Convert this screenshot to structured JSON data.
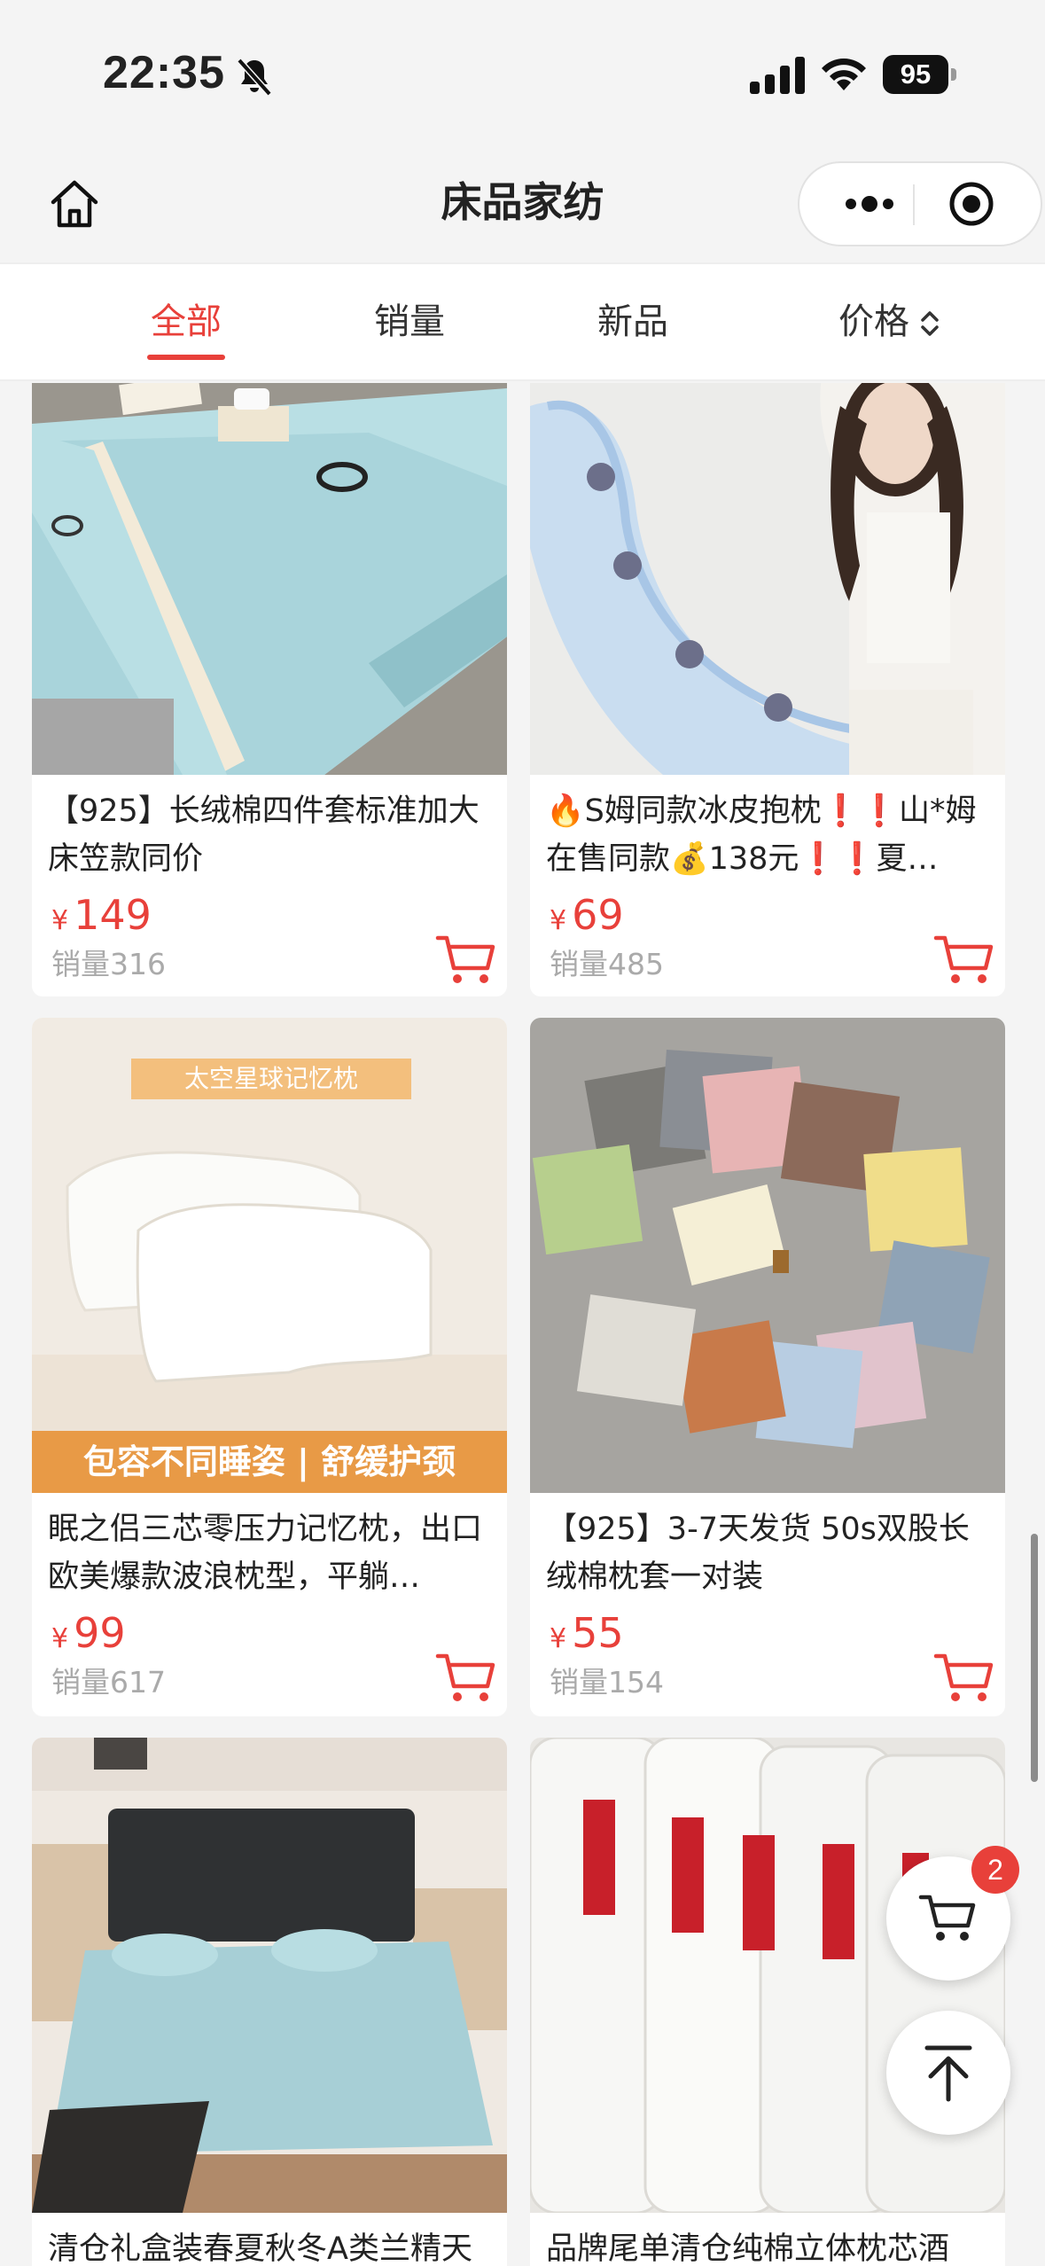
{
  "status_bar": {
    "time": "22:35",
    "battery": "95"
  },
  "nav": {
    "title": "床品家纺"
  },
  "tabs": [
    {
      "label": "全部",
      "active": true
    },
    {
      "label": "销量",
      "active": false
    },
    {
      "label": "新品",
      "active": false
    },
    {
      "label": "价格",
      "active": false
    }
  ],
  "products": [
    {
      "name": "【925】长绒棉四件套标准加大床笠款同价",
      "currency": "¥",
      "price": "149",
      "sold": "销量316"
    },
    {
      "name": "🔥S姆同款冰皮抱枕❗️❗️山*姆在售同款💰138元❗️❗️夏…",
      "currency": "¥",
      "price": "69",
      "sold": "销量485"
    },
    {
      "name": "眠之侣三芯零压力记忆枕，出口欧美爆款波浪枕型，平躺…",
      "currency": "¥",
      "price": "99",
      "sold": "销量617",
      "image_banner_top": "太空星球记忆枕",
      "image_banner_bottom": "包容不同睡姿 | 舒缓护颈"
    },
    {
      "name": "【925】3-7天发货 50s双股长绒棉枕套一对装",
      "currency": "¥",
      "price": "55",
      "sold": "销量154"
    },
    {
      "name": "清仓礼盒装春夏秋冬A类兰精天",
      "currency": "",
      "price": "",
      "sold": ""
    },
    {
      "name": "品牌尾单清仓纯棉立体枕芯酒",
      "currency": "",
      "price": "",
      "sold": ""
    }
  ],
  "floating": {
    "cart_badge": "2"
  },
  "colors": {
    "accent": "#e8403a",
    "background": "#f4f4f4",
    "card": "#ffffff",
    "muted_text": "#aaaaaa"
  }
}
